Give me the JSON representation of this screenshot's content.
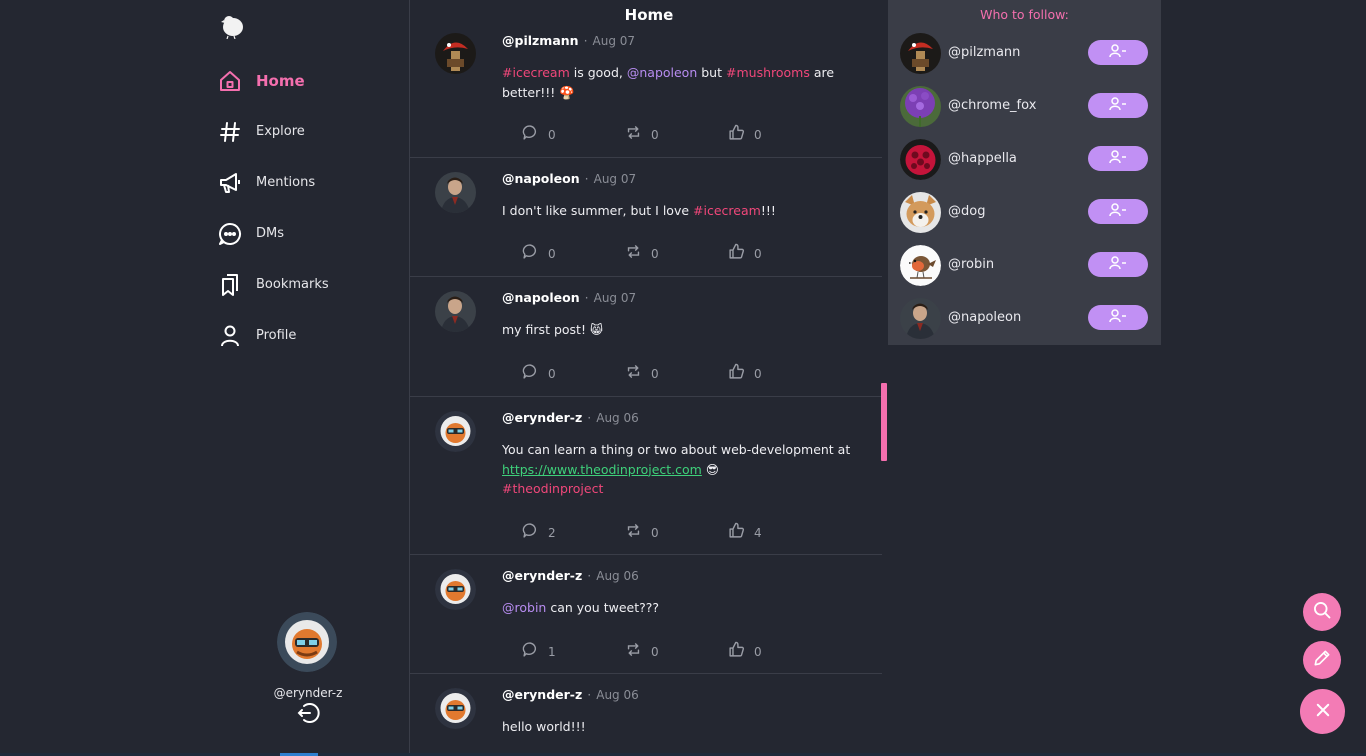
{
  "sidebar": {
    "logo": "bird-logo",
    "items": [
      {
        "label": "Home",
        "icon": "home-icon",
        "active": true
      },
      {
        "label": "Explore",
        "icon": "hashtag-icon"
      },
      {
        "label": "Mentions",
        "icon": "megaphone-icon"
      },
      {
        "label": "DMs",
        "icon": "chat-icon"
      },
      {
        "label": "Bookmarks",
        "icon": "bookmarks-icon"
      },
      {
        "label": "Profile",
        "icon": "user-icon"
      }
    ],
    "user": {
      "handle": "@erynder-z"
    }
  },
  "feed": {
    "title": "Home",
    "posts": [
      {
        "author": "@pilzmann",
        "date": "Aug 07",
        "comments": "0",
        "reposts": "0",
        "likes": "0"
      },
      {
        "author": "@napoleon",
        "date": "Aug 07",
        "comments": "0",
        "reposts": "0",
        "likes": "0",
        "text": "I don't like summer, but I love",
        "tag": "#icecream",
        "suffix": "!!!"
      },
      {
        "author": "@napoleon",
        "date": "Aug 07",
        "comments": "0",
        "reposts": "0",
        "likes": "0",
        "text": "my first post! 😸"
      },
      {
        "author": "@erynder-z",
        "date": "Aug 06",
        "comments": "2",
        "reposts": "0",
        "likes": "4",
        "text": "You can learn a thing or two about web-development at",
        "link": "https://www.theodinproject.com",
        "emoji": "😎",
        "tag": "#theodinproject"
      },
      {
        "author": "@erynder-z",
        "date": "Aug 06",
        "comments": "1",
        "reposts": "0",
        "likes": "0",
        "mention": "@robin",
        "text": "can you tweet???"
      },
      {
        "author": "@erynder-z",
        "date": "Aug 06",
        "text": "hello world!!!"
      }
    ],
    "post0": {
      "tag1": "#icecream",
      "t1": "is good,",
      "mention": "@napoleon",
      "t2": "but",
      "tag2": "#mushrooms",
      "t3": "are better!!! 🍄"
    }
  },
  "who_to_follow": {
    "title": "Who to follow:",
    "users": [
      {
        "handle": "@pilzmann"
      },
      {
        "handle": "@chrome_fox"
      },
      {
        "handle": "@happella"
      },
      {
        "handle": "@dog"
      },
      {
        "handle": "@robin"
      },
      {
        "handle": "@napoleon"
      }
    ]
  },
  "fabs": [
    "search-icon",
    "pencil-icon",
    "close-icon"
  ],
  "colors": {
    "background": "#242731",
    "accent_pink": "#f46fae",
    "hashtag": "#f0477a",
    "mention": "#b78cf0",
    "link": "#3ed07a",
    "follow_button": "#c190f4",
    "panel": "#3a3d47"
  }
}
